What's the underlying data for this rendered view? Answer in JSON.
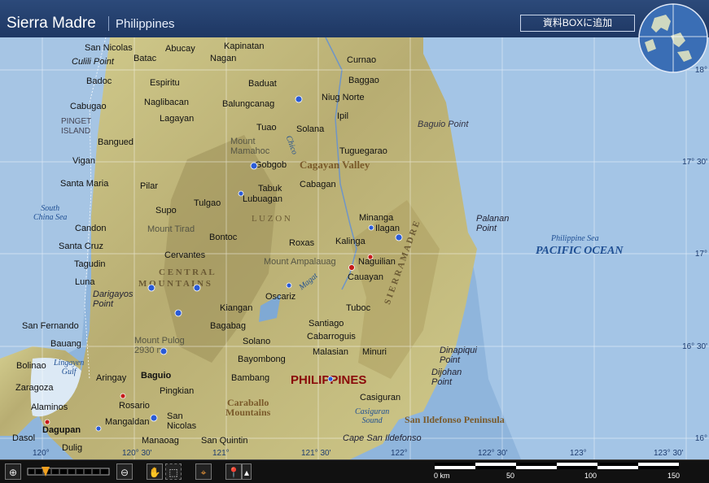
{
  "header": {
    "title": "Sierra Madre",
    "subtitle": "Philippines",
    "add_button": "資料BOXに追加"
  },
  "lat_ticks": [
    "18°",
    "17° 30'",
    "17°",
    "16° 30'",
    "16°"
  ],
  "lon_ticks": [
    "120°",
    "120° 30'",
    "121°",
    "121° 30'",
    "122°",
    "122° 30'",
    "123°",
    "123° 30'"
  ],
  "places": {
    "san_nicolas": "San Nicolas",
    "batac": "Batac",
    "abucay": "Abucay",
    "kapinatan": "Kapinatan",
    "nagan": "Nagan",
    "curnao": "Curnao",
    "culili_point": "Culili Point",
    "badoc": "Badoc",
    "espiritu": "Espiritu",
    "baduat": "Baduat",
    "baggao": "Baggao",
    "cabugao": "Cabugao",
    "naglibacan": "Naglibacan",
    "balungcanag": "Balungcanag",
    "niug_norte": "Niug Norte",
    "pinget_island": "PINGET\nISLAND",
    "lagayan": "Lagayan",
    "ipil": "Ipil",
    "baguio_point": "Baguio Point",
    "tuao": "Tuao",
    "solana": "Solana",
    "bangued": "Bangued",
    "mount_mamahoc": "Mount\nMamahoc",
    "tuguegarao": "Tuguegarao",
    "vigan": "Vigan",
    "gobgob": "Gobgob",
    "cagayan_valley": "Cagayan Valley",
    "santa_maria": "Santa Maria",
    "pilar": "Pilar",
    "tabuk": "Tabuk",
    "lubuagan": "Lubuagan",
    "cabagan": "Cabagan",
    "south_china_sea": "South\nChina Sea",
    "supo": "Supo",
    "tulgao": "Tulgao",
    "luzon": "L U Z O N",
    "minanga": "Minanga",
    "ilagan": "Ilagan",
    "palanan_point": "Palanan\nPoint",
    "candon": "Candon",
    "mount_tirad": "Mount Tirad",
    "bontoc": "Bontoc",
    "roxas": "Roxas",
    "kalinga": "Kalinga",
    "philippine_sea": "Philippine Sea",
    "santa_cruz": "Santa Cruz",
    "cervantes": "Cervantes",
    "mount_ampalauag": "Mount Ampalauag",
    "naguilian": "Naguilian",
    "pacific_ocean": "PACIFIC OCEAN",
    "tagudin": "Tagudin",
    "central": "C E N T R A L",
    "cauayan": "Cauayan",
    "luna": "Luna",
    "mountains": "M O U N T A I N S",
    "darigayos_point": "Darigayos\nPoint",
    "oscariz": "Oscariz",
    "tuboc": "Tuboc",
    "kiangan": "Kiangan",
    "san_fernando": "San Fernando",
    "bagabag": "Bagabag",
    "santiago": "Santiago",
    "bauang": "Bauang",
    "mount_pulog": "Mount Pulog\n2930 m",
    "solano": "Solano",
    "cabarroguis": "Cabarroguis",
    "sierra_madre_lbl": "S I E R R A   M A D R E",
    "malasian": "Malasian",
    "minuri": "Minuri",
    "dinapiqui_point": "Dinapiqui\nPoint",
    "lingayen_gulf": "Lingayen\nGulf",
    "bolinao": "Bolinao",
    "bayombong": "Bayombong",
    "aringay": "Aringay",
    "baguio": "Baguio",
    "bambang": "Bambang",
    "philippines": "PHILIPPINES",
    "dijohan_point": "Dijohan\nPoint",
    "zaragoza": "Zaragoza",
    "pingkian": "Pingkian",
    "casiguran": "Casiguran",
    "alaminos": "Alaminos",
    "rosario": "Rosario",
    "caraballo": "Caraballo\nMountains",
    "casiguran_sound": "Casiguran\nSound",
    "san_ildefonso_peninsula": "San Ildefonso Peninsula",
    "dagupan": "Dagupan",
    "mangaldan": "Mangaldan",
    "san_nicolas2": "San\nNicolas",
    "dasol": "Dasol",
    "manaoag": "Manaoag",
    "dulig": "Dulig",
    "san_quintin": "San Quintin",
    "cape_san_ildefonso": "Cape San Ildefonso",
    "cagayan_river": "Chico",
    "magat": "Magat"
  },
  "toolbar": {
    "zoom_in": "zoom-in",
    "zoom_out": "zoom-out",
    "pan": "hand",
    "select": "select",
    "center": "crosshair",
    "marker": "marker",
    "zoom_level": 0.22
  },
  "scale": {
    "labels": [
      "0 km",
      "50",
      "100",
      "150"
    ]
  },
  "colors": {
    "ocean": "#8eb6dd",
    "shelf": "#b7d3ef",
    "land_low": "#c9c58a",
    "land_high": "#a89a62",
    "header": "#233f6c"
  }
}
